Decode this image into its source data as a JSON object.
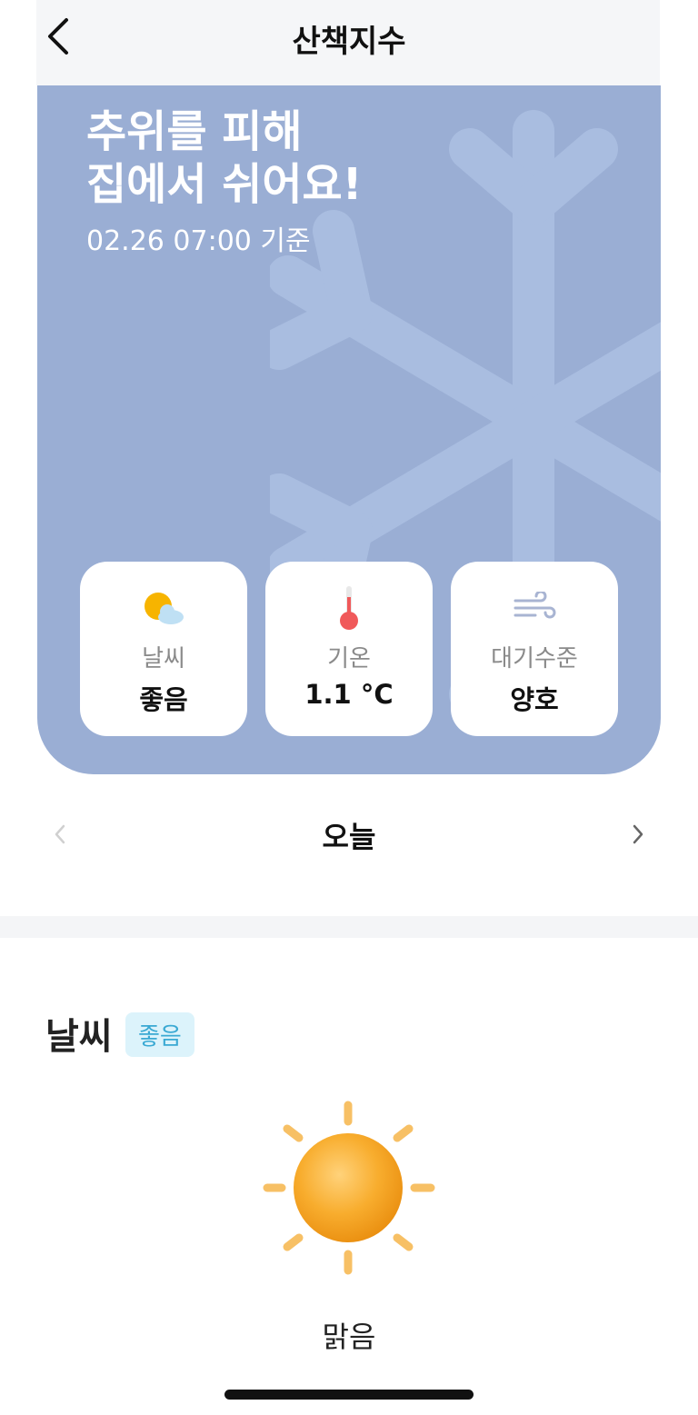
{
  "header": {
    "title": "산책지수",
    "back_icon": "chevron-left-icon"
  },
  "hero": {
    "title": "추위를 피해\n집에서 쉬어요!",
    "timestamp": "02.26 07:00 기준",
    "background_color": "#9aaed4",
    "decoration_icon": "snowflake-icon",
    "cards": [
      {
        "icon": "partly-sunny-icon",
        "label": "날씨",
        "value": "좋음"
      },
      {
        "icon": "thermometer-icon",
        "label": "기온",
        "value": "1.1 °C"
      },
      {
        "icon": "wind-icon",
        "label": "대기수준",
        "value": "양호"
      }
    ]
  },
  "day_nav": {
    "label": "오늘",
    "prev_icon": "chevron-left-icon",
    "next_icon": "chevron-right-icon"
  },
  "weather_section": {
    "title": "날씨",
    "badge": "좋음",
    "badge_color": "#3aa9d3",
    "icon": "sun-icon",
    "description": "맑음"
  }
}
